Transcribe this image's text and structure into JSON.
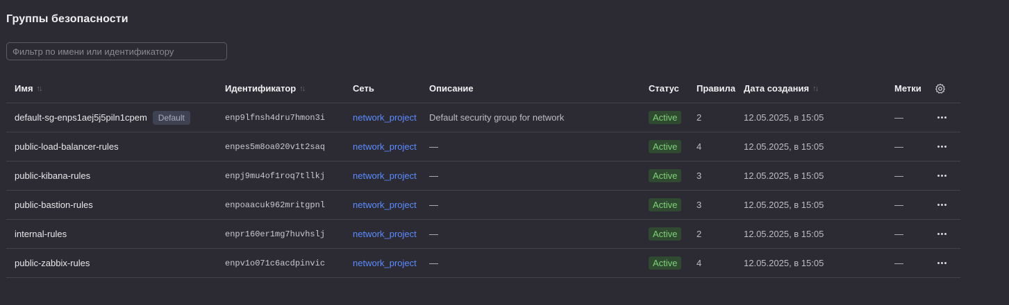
{
  "page": {
    "title": "Группы безопасности",
    "filter_placeholder": "Фильтр по имени или идентификатору"
  },
  "columns": {
    "name": "Имя",
    "id": "Идентификатор",
    "network": "Сеть",
    "description": "Описание",
    "status": "Статус",
    "rules": "Правила",
    "created": "Дата создания",
    "labels": "Метки"
  },
  "icons": {
    "sort": "sort-icon",
    "settings": "gear-icon",
    "row_menu": "more-horizontal-icon"
  },
  "rows": [
    {
      "name": "default-sg-enps1aej5j5piln1cpem",
      "badge": "Default",
      "id": "enp9lfnsh4dru7hmon3i",
      "network": "network_project",
      "description": "Default security group for network",
      "status": "Active",
      "rules": "2",
      "created": "12.05.2025, в 15:05",
      "labels": "—"
    },
    {
      "name": "public-load-balancer-rules",
      "badge": "",
      "id": "enpes5m8oa020v1t2saq",
      "network": "network_project",
      "description": "—",
      "status": "Active",
      "rules": "4",
      "created": "12.05.2025, в 15:05",
      "labels": "—"
    },
    {
      "name": "public-kibana-rules",
      "badge": "",
      "id": "enpj9mu4of1roq7tllkj",
      "network": "network_project",
      "description": "—",
      "status": "Active",
      "rules": "3",
      "created": "12.05.2025, в 15:05",
      "labels": "—"
    },
    {
      "name": "public-bastion-rules",
      "badge": "",
      "id": "enpoaacuk962mritgpnl",
      "network": "network_project",
      "description": "—",
      "status": "Active",
      "rules": "3",
      "created": "12.05.2025, в 15:05",
      "labels": "—"
    },
    {
      "name": "internal-rules",
      "badge": "",
      "id": "enpr160er1mg7huvhslj",
      "network": "network_project",
      "description": "—",
      "status": "Active",
      "rules": "2",
      "created": "12.05.2025, в 15:05",
      "labels": "—"
    },
    {
      "name": "public-zabbix-rules",
      "badge": "",
      "id": "enpv1o071c6acdpinvic",
      "network": "network_project",
      "description": "—",
      "status": "Active",
      "rules": "4",
      "created": "12.05.2025, в 15:05",
      "labels": "—"
    }
  ],
  "colors": {
    "background": "#2c2b33",
    "link": "#5b8cff",
    "status_active_text": "#7fd27a",
    "status_active_bg": "#2f4a30",
    "default_badge_bg": "#3e4252"
  }
}
